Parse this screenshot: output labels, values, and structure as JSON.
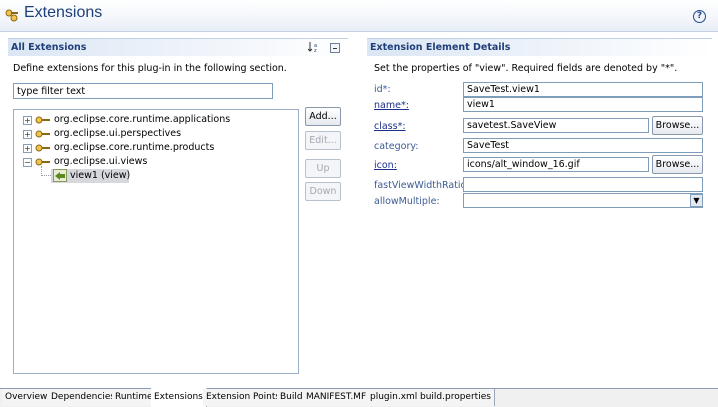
{
  "header": {
    "title": "Extensions",
    "help_icon": "help-icon"
  },
  "left": {
    "title": "All Extensions",
    "description": "Define extensions for this plug-in in the following section.",
    "filter_value": "type filter text",
    "tree": [
      {
        "label": "org.eclipse.core.runtime.applications",
        "expanded": false
      },
      {
        "label": "org.eclipse.ui.perspectives",
        "expanded": false
      },
      {
        "label": "org.eclipse.core.runtime.products",
        "expanded": false
      },
      {
        "label": "org.eclipse.ui.views",
        "expanded": true
      },
      {
        "label": "view1 (view)",
        "selected": true
      }
    ],
    "toggle_collapsed": "+",
    "toggle_expanded": "−",
    "buttons": {
      "add": "Add...",
      "edit": "Edit...",
      "up": "Up",
      "down": "Down"
    }
  },
  "right": {
    "title": "Extension Element Details",
    "description": "Set the properties of \"view\". Required fields are denoted by \"*\".",
    "props": {
      "id": {
        "label": "id*:",
        "value": "SaveTest.view1"
      },
      "name": {
        "label": "name*:",
        "value": "view1"
      },
      "class": {
        "label": "class*:",
        "value": "savetest.SaveView",
        "button": "Browse..."
      },
      "category": {
        "label": "category:",
        "value": "SaveTest"
      },
      "icon": {
        "label": "icon:",
        "value": "icons/alt_window_16.gif",
        "button": "Browse..."
      },
      "fastViewWidthRatio": {
        "label": "fastViewWidthRatio:",
        "value": ""
      },
      "allowMultiple": {
        "label": "allowMultiple:",
        "value": ""
      }
    }
  },
  "tabs": [
    {
      "label": "Overview"
    },
    {
      "label": "Dependencies"
    },
    {
      "label": "Runtime"
    },
    {
      "label": "Extensions",
      "active": true
    },
    {
      "label": "Extension Points"
    },
    {
      "label": "Build"
    },
    {
      "label": "MANIFEST.MF"
    },
    {
      "label": "plugin.xml"
    },
    {
      "label": "build.properties"
    }
  ],
  "colors": {
    "accent": "#1f3f7a",
    "link": "#1c2f8a",
    "selection": "#d6d8de"
  }
}
